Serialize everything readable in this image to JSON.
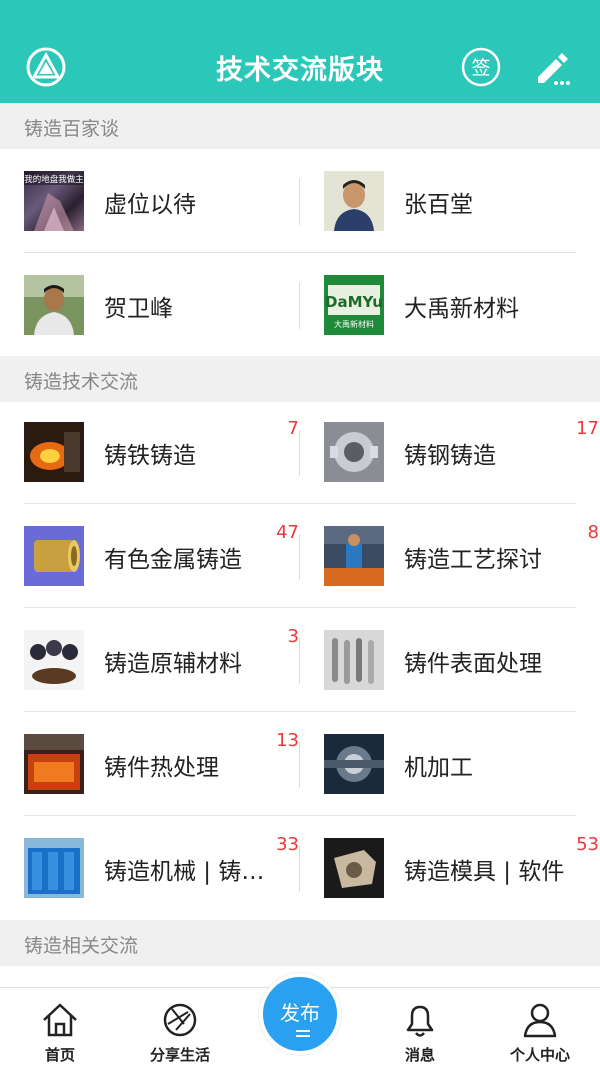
{
  "header": {
    "title": "技术交流版块"
  },
  "sections": [
    {
      "title": "铸造百家谈"
    },
    {
      "title": "铸造技术交流"
    },
    {
      "title": "铸造相关交流"
    }
  ],
  "baijia": [
    {
      "label": "虚位以待",
      "badge": ""
    },
    {
      "label": "张百堂",
      "badge": ""
    },
    {
      "label": "贺卫峰",
      "badge": ""
    },
    {
      "label": "大禹新材料",
      "badge": ""
    }
  ],
  "tech": [
    {
      "label": "铸铁铸造",
      "badge": "7"
    },
    {
      "label": "铸钢铸造",
      "badge": "17"
    },
    {
      "label": "有色金属铸造",
      "badge": "47"
    },
    {
      "label": "铸造工艺探讨",
      "badge": "8"
    },
    {
      "label": "铸造原辅材料",
      "badge": "3"
    },
    {
      "label": "铸件表面处理",
      "badge": ""
    },
    {
      "label": "铸件热处理",
      "badge": "13"
    },
    {
      "label": "机加工",
      "badge": ""
    },
    {
      "label": "铸造机械 | 铸…",
      "badge": "33"
    },
    {
      "label": "铸造模具 | 软件",
      "badge": "53"
    }
  ],
  "thumbs": {
    "logo_text": "我的地盘我做主",
    "damyu_text": "DaMYu",
    "damyu_sub": "大禹新材料"
  },
  "tabbar": {
    "home": "首页",
    "share": "分享生活",
    "publish": "发布",
    "messages": "消息",
    "profile": "个人中心"
  },
  "colors": {
    "accent": "#2bc7b8",
    "badge": "#e83a3a",
    "publish": "#2aa0f0"
  }
}
